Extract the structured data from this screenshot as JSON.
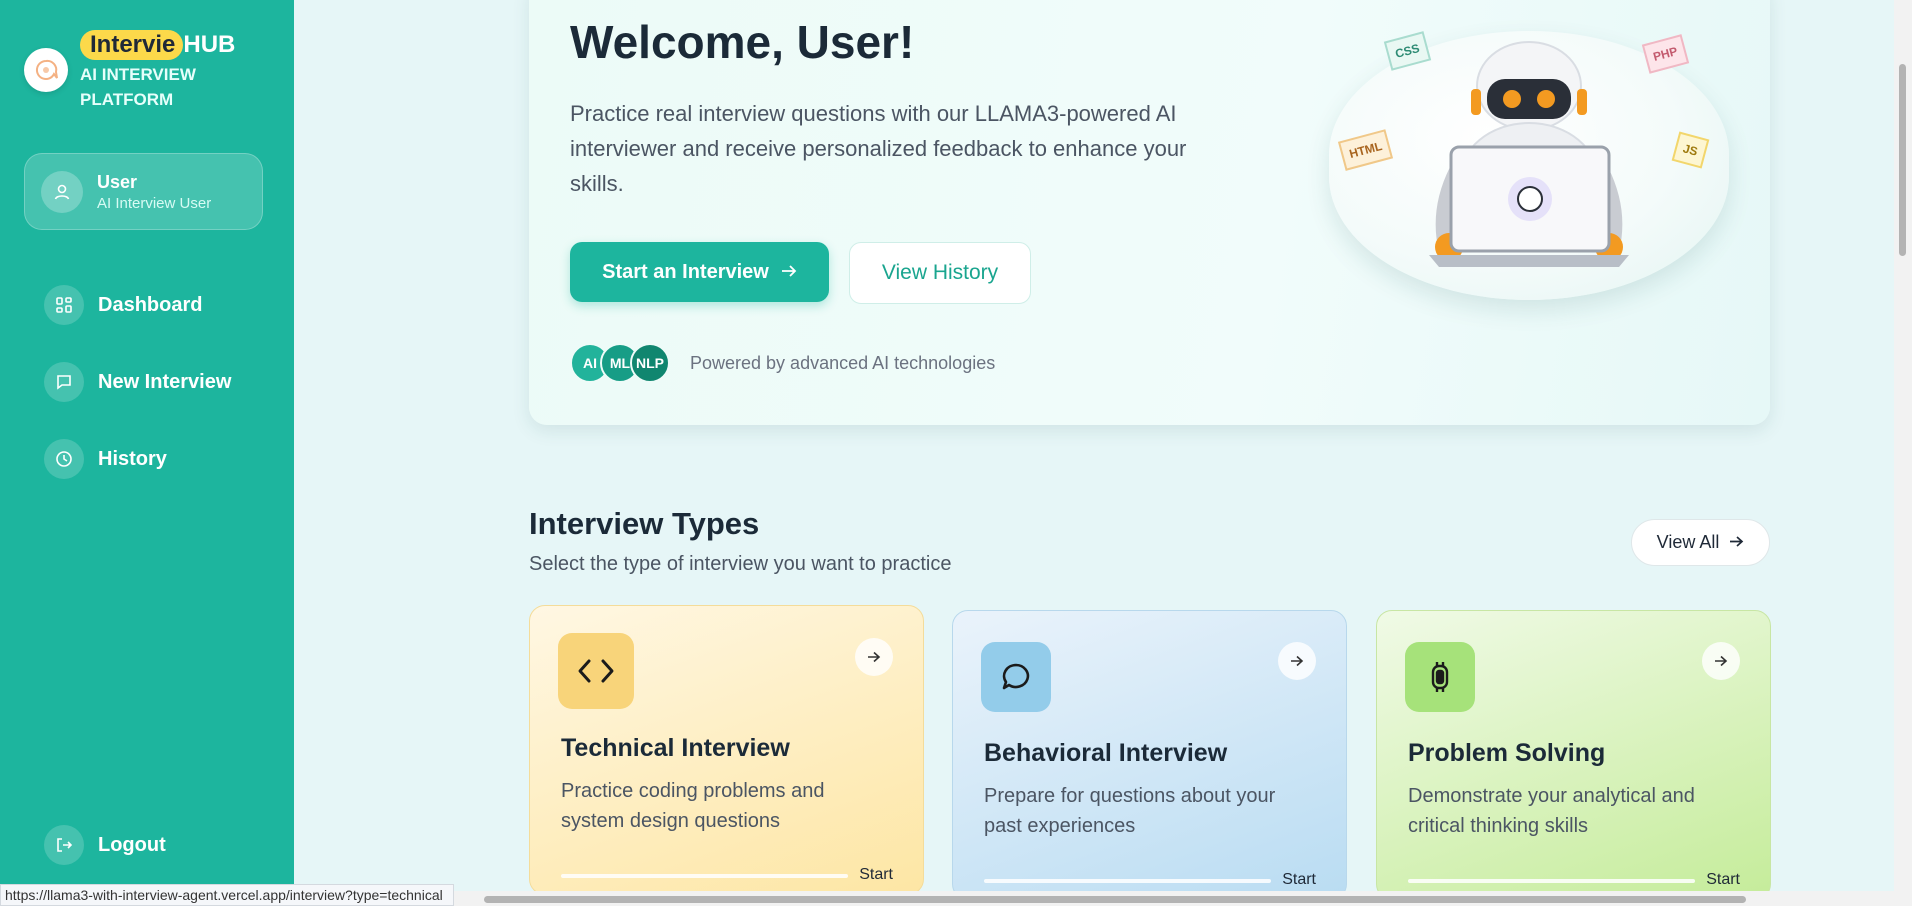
{
  "brand": {
    "highlight": "Intervie",
    "rest": "HUB",
    "subtitle": "AI INTERVIEW PLATFORM"
  },
  "user": {
    "name": "User",
    "role": "AI Interview User"
  },
  "nav": {
    "items": [
      {
        "label": "Dashboard",
        "icon": "grid-icon"
      },
      {
        "label": "New Interview",
        "icon": "chat-icon"
      },
      {
        "label": "History",
        "icon": "clock-icon"
      }
    ],
    "logout": "Logout"
  },
  "hero": {
    "title": "Welcome, User!",
    "description": "Practice real interview questions with our LLAMA3-powered AI interviewer and receive personalized feedback to enhance your skills.",
    "primary_button": "Start an Interview",
    "secondary_button": "View History",
    "badges": [
      "AI",
      "ML",
      "NLP"
    ],
    "powered_text": "Powered by advanced AI technologies",
    "tags": [
      "CSS",
      "PHP",
      "HTML",
      "JS"
    ]
  },
  "types": {
    "title": "Interview Types",
    "subtitle": "Select the type of interview you want to practice",
    "view_all": "View All",
    "cards": [
      {
        "title": "Technical Interview",
        "description": "Practice coding problems and system design questions",
        "start": "Start",
        "icon": "code-icon"
      },
      {
        "title": "Behavioral Interview",
        "description": "Prepare for questions about your past experiences",
        "start": "Start",
        "icon": "speech-bubble-icon"
      },
      {
        "title": "Problem Solving",
        "description": "Demonstrate your analytical and critical thinking skills",
        "start": "Start",
        "icon": "brain-chip-icon"
      }
    ]
  },
  "status_bar": {
    "url": "https://llama3-with-interview-agent.vercel.app/interview?type=technical"
  },
  "colors": {
    "primary": "#1db59e",
    "highlight": "#fcd94a"
  }
}
